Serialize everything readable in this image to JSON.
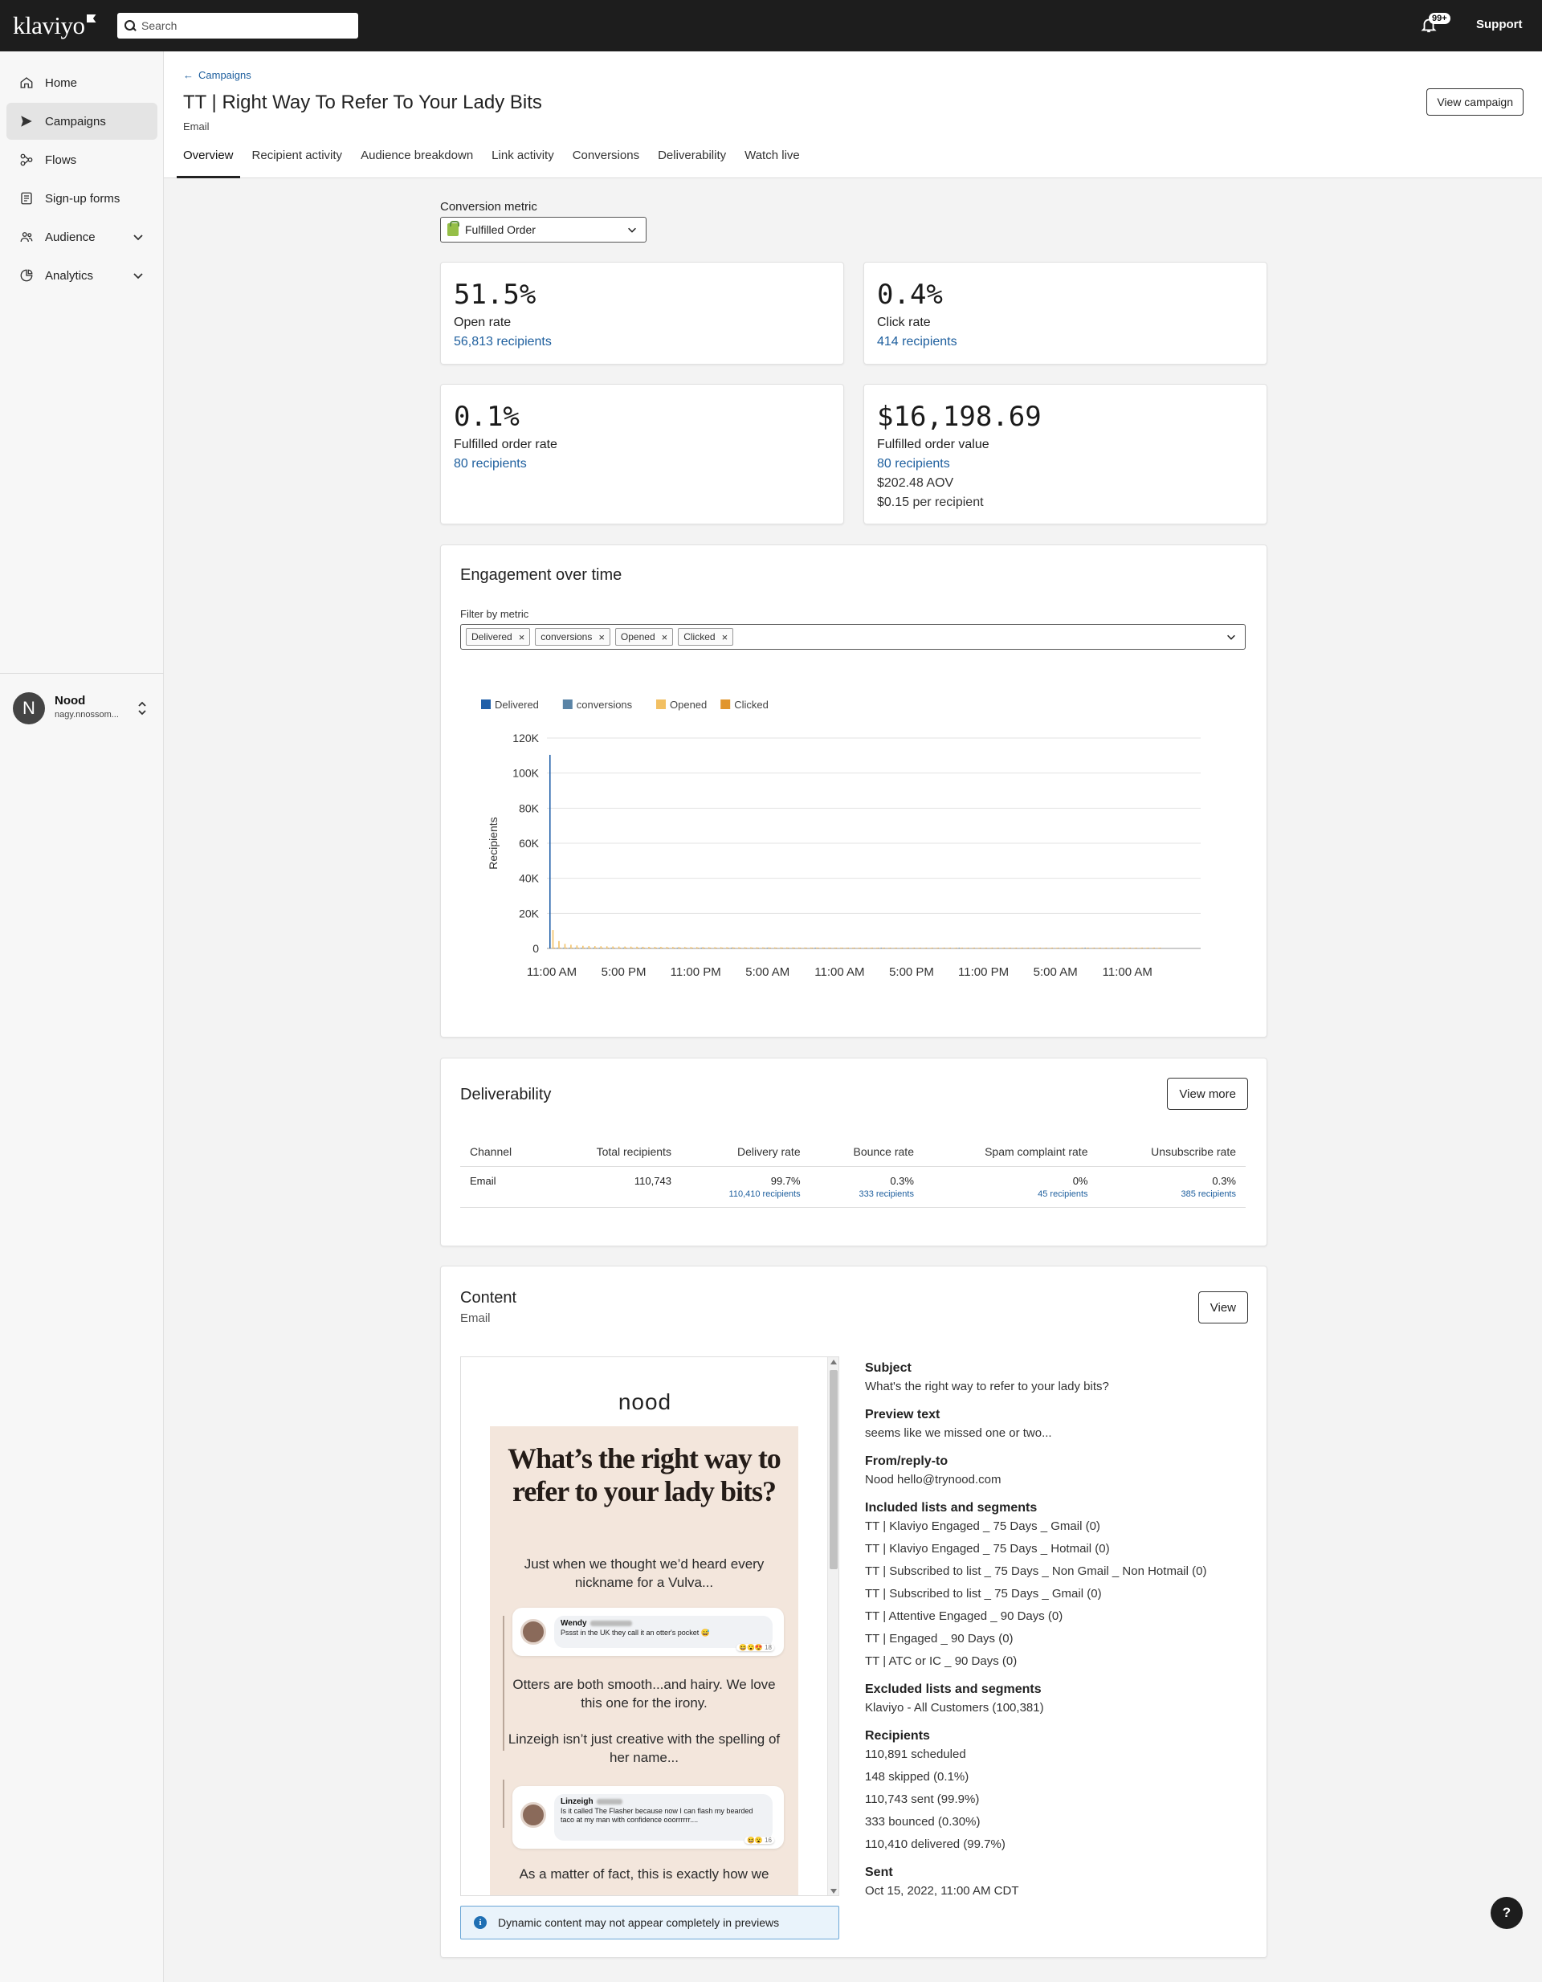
{
  "topbar": {
    "logo": "klaviyo",
    "search_placeholder": "Search",
    "notifications_badge": "99+",
    "support_label": "Support"
  },
  "sidebar": {
    "items": [
      {
        "label": "Home",
        "icon": "home-icon"
      },
      {
        "label": "Campaigns",
        "icon": "send-icon",
        "active": true
      },
      {
        "label": "Flows",
        "icon": "flows-icon"
      },
      {
        "label": "Sign-up forms",
        "icon": "form-icon"
      },
      {
        "label": "Audience",
        "icon": "audience-icon",
        "expandable": true
      },
      {
        "label": "Analytics",
        "icon": "analytics-icon",
        "expandable": true
      }
    ],
    "account": {
      "initial": "N",
      "name": "Nood",
      "email": "nagy.nnossom..."
    }
  },
  "header": {
    "breadcrumb": "Campaigns",
    "title": "TT | Right Way To Refer To Your Lady Bits",
    "subtitle": "Email",
    "view_campaign_label": "View campaign",
    "tabs": [
      {
        "label": "Overview",
        "active": true
      },
      {
        "label": "Recipient activity"
      },
      {
        "label": "Audience breakdown"
      },
      {
        "label": "Link activity"
      },
      {
        "label": "Conversions"
      },
      {
        "label": "Deliverability"
      },
      {
        "label": "Watch live"
      }
    ]
  },
  "conversion_metric": {
    "label": "Conversion metric",
    "selected": "Fulfilled Order"
  },
  "metrics": {
    "open": {
      "value": "51.5%",
      "label": "Open rate",
      "link": "56,813 recipients"
    },
    "click": {
      "value": "0.4%",
      "label": "Click rate",
      "link": "414 recipients"
    },
    "fulfilled_rate": {
      "value": "0.1%",
      "label": "Fulfilled order rate",
      "link": "80 recipients"
    },
    "fulfilled_value": {
      "value": "$16,198.69",
      "label": "Fulfilled order value",
      "link": "80 recipients",
      "aov": "$202.48 AOV",
      "per_recipient": "$0.15 per recipient"
    }
  },
  "engagement": {
    "title": "Engagement over time",
    "filter_label": "Filter by metric",
    "chips": [
      "Delivered",
      "conversions",
      "Opened",
      "Clicked"
    ]
  },
  "chart_data": {
    "type": "bar",
    "ylabel": "Recipients",
    "ylim": [
      0,
      120000
    ],
    "yticks": [
      "0",
      "20K",
      "40K",
      "60K",
      "80K",
      "100K",
      "120K"
    ],
    "yticks_values": [
      0,
      20000,
      40000,
      60000,
      80000,
      100000,
      120000
    ],
    "xticks": [
      "11:00 AM",
      "5:00 PM",
      "11:00 PM",
      "5:00 AM",
      "11:00 AM",
      "5:00 PM",
      "11:00 PM",
      "5:00 AM",
      "11:00 AM"
    ],
    "grid": true,
    "legend_placement": "top-left",
    "bins_per_hour": 2,
    "series": [
      {
        "name": "Delivered",
        "color": "#1f5fa8",
        "values": [
          110410,
          0,
          0,
          0,
          0,
          0,
          0,
          0,
          0,
          0,
          0,
          0,
          0,
          0,
          0,
          0,
          0,
          0,
          0,
          0,
          0,
          0,
          0,
          0,
          0,
          0,
          0,
          0,
          0,
          0,
          0,
          0,
          0,
          0,
          0,
          0,
          0,
          0,
          0,
          0,
          0,
          0,
          0,
          0,
          0,
          0,
          0,
          0,
          0,
          0,
          0,
          0,
          0,
          0,
          0,
          0,
          0,
          0,
          0,
          0,
          0,
          0,
          0,
          0,
          0,
          0,
          0,
          0,
          0,
          0,
          0,
          0,
          0,
          0,
          0,
          0,
          0,
          0,
          0,
          0,
          0,
          0,
          0,
          0,
          0,
          0,
          0,
          0,
          0,
          0,
          0,
          0,
          0,
          0,
          0,
          0,
          0,
          0,
          0,
          0,
          0,
          0
        ]
      },
      {
        "name": "conversions",
        "color": "#5a84a6",
        "values": [
          0,
          2,
          3,
          2,
          1,
          1,
          1,
          1,
          1,
          0,
          1,
          0,
          1,
          0,
          0,
          1,
          0,
          0,
          1,
          0,
          0,
          1,
          0,
          0,
          0,
          1,
          0,
          0,
          0,
          0,
          1,
          0,
          0,
          0,
          0,
          0,
          1,
          0,
          0,
          0,
          0,
          0,
          0,
          0,
          1,
          0,
          0,
          0,
          0,
          0,
          0,
          0,
          0,
          0,
          0,
          1,
          0,
          0,
          0,
          0,
          0,
          0,
          0,
          0,
          0,
          0,
          0,
          0,
          1,
          0,
          0,
          0,
          0,
          0,
          0,
          0,
          0,
          0,
          0,
          0,
          0,
          0,
          0,
          0,
          0,
          0,
          0,
          0,
          0,
          1,
          0,
          0,
          0,
          0,
          0,
          0,
          0,
          0,
          0,
          0,
          0,
          0
        ]
      },
      {
        "name": "Opened",
        "color": "#f2c063",
        "values": [
          10500,
          4200,
          2600,
          2100,
          1700,
          1500,
          1400,
          1300,
          1250,
          1200,
          1150,
          1100,
          1080,
          1050,
          1000,
          950,
          900,
          880,
          860,
          840,
          820,
          800,
          780,
          760,
          740,
          720,
          700,
          690,
          680,
          670,
          660,
          650,
          640,
          630,
          620,
          610,
          600,
          590,
          580,
          570,
          560,
          550,
          540,
          530,
          520,
          510,
          500,
          490,
          480,
          470,
          460,
          450,
          440,
          430,
          420,
          410,
          400,
          390,
          380,
          370,
          360,
          350,
          340,
          330,
          320,
          310,
          300,
          290,
          280,
          270,
          260,
          250,
          240,
          230,
          220,
          210,
          200,
          190,
          180,
          170,
          160,
          150,
          140,
          130,
          120,
          110,
          100,
          95,
          90,
          85,
          80,
          75,
          70,
          65,
          60,
          55,
          50,
          45,
          40,
          35,
          30,
          25
        ]
      },
      {
        "name": "Clicked",
        "color": "#e1952c",
        "values": [
          120,
          60,
          40,
          30,
          20,
          15,
          12,
          10,
          9,
          8,
          7,
          6,
          6,
          5,
          5,
          4,
          4,
          4,
          3,
          3,
          3,
          3,
          2,
          2,
          2,
          2,
          2,
          2,
          2,
          2,
          1,
          1,
          1,
          1,
          1,
          1,
          1,
          1,
          1,
          1,
          1,
          1,
          1,
          1,
          1,
          1,
          1,
          1,
          1,
          1,
          1,
          1,
          1,
          1,
          1,
          1,
          1,
          1,
          1,
          1,
          1,
          1,
          1,
          1,
          1,
          1,
          1,
          1,
          1,
          1,
          1,
          1,
          1,
          1,
          1,
          1,
          1,
          1,
          1,
          1,
          1,
          1,
          1,
          1,
          1,
          1,
          1,
          1,
          1,
          1,
          1,
          1,
          1,
          1,
          1,
          1,
          1,
          1,
          1,
          1,
          1,
          1
        ]
      }
    ]
  },
  "deliverability": {
    "title": "Deliverability",
    "view_more_label": "View more",
    "columns": [
      "Channel",
      "Total recipients",
      "Delivery rate",
      "Bounce rate",
      "Spam complaint rate",
      "Unsubscribe rate"
    ],
    "row": {
      "channel": "Email",
      "total": "110,743",
      "delivery_rate": "99.7%",
      "delivery_sub": "110,410 recipients",
      "bounce_rate": "0.3%",
      "bounce_sub": "333 recipients",
      "spam_rate": "0%",
      "spam_sub": "45 recipients",
      "unsub_rate": "0.3%",
      "unsub_sub": "385 recipients"
    }
  },
  "content": {
    "title": "Content",
    "subtitle": "Email",
    "view_label": "View",
    "preview": {
      "brand": "nood",
      "headline": "What’s the right way to refer to your lady bits?",
      "intro": "Just when we thought we’d heard every nickname for a Vulva...",
      "comment1_name": "Wendy",
      "comment1_text": "Pssst in the UK they call it an otter's pocket 😅",
      "comment1_react": "😆😮😍 18",
      "body2": "Otters are both smooth...and hairy. We love this one for the irony.",
      "body3": "Linzeigh isn’t just creative with the spelling of her name...",
      "comment2_name": "Linzeigh",
      "comment2_text": "Is it called The Flasher because now I can flash my bearded taco at my man with confidence ooorrrrrr....",
      "comment2_react": "😆😮 16",
      "body4": "As a matter of fact, this is exactly how we"
    },
    "banner": "Dynamic content may not appear completely in previews",
    "subject_label": "Subject",
    "subject": "What's the right way to refer to your lady bits?",
    "preview_text_label": "Preview text",
    "preview_text": "seems like we missed one or two...",
    "from_label": "From/reply-to",
    "from": "Nood hello@trynood.com",
    "included_label": "Included lists and segments",
    "included": [
      "TT | Klaviyo Engaged _ 75 Days _ Gmail (0)",
      "TT | Klaviyo Engaged _ 75 Days _ Hotmail (0)",
      "TT | Subscribed to list _ 75 Days _ Non Gmail _ Non Hotmail (0)",
      "TT | Subscribed to list _ 75 Days _ Gmail (0)",
      "TT | Attentive Engaged _ 90 Days (0)",
      "TT | Engaged _ 90 Days (0)",
      "TT | ATC or IC _ 90 Days (0)"
    ],
    "excluded_label": "Excluded lists and segments",
    "excluded": [
      "Klaviyo - All Customers (100,381)"
    ],
    "recipients_label": "Recipients",
    "recipients": [
      "110,891 scheduled",
      "148 skipped (0.1%)",
      "110,743 sent (99.9%)",
      "333 bounced (0.30%)",
      "110,410 delivered (99.7%)"
    ],
    "sent_label": "Sent",
    "sent": "Oct 15, 2022, 11:00 AM CDT"
  },
  "help_label": "?"
}
